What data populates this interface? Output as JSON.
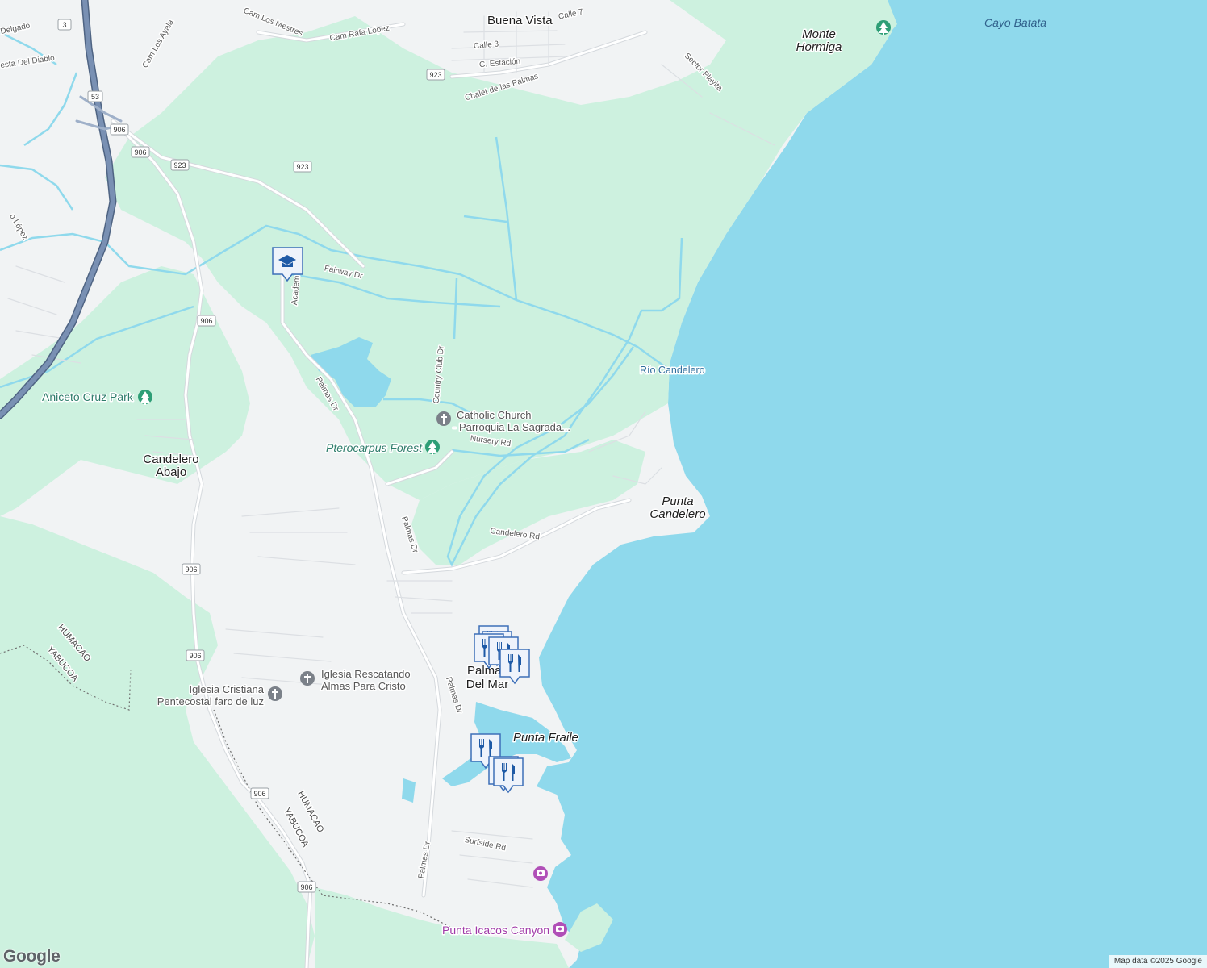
{
  "map": {
    "places": {
      "buena_vista": "Buena Vista",
      "monte_hormiga": [
        "Monte",
        "Hormiga"
      ],
      "cayo_batata": "Cayo Batata",
      "candelero_abajo": [
        "Candelero",
        "Abajo"
      ],
      "punta_candelero": [
        "Punta",
        "Candelero"
      ],
      "palmas_del_mar": [
        "Palmas",
        "Del Mar"
      ],
      "punta_fraile": "Punta Fraile"
    },
    "pois": {
      "aniceto_cruz_park": "Aniceto Cruz Park",
      "pterocarpus_forest": "Pterocarpus Forest",
      "catholic_church": [
        "Catholic Church",
        "- Parroquia La Sagrada..."
      ],
      "iglesia_rescatando": [
        "Iglesia Rescatando",
        "Almas Para Cristo"
      ],
      "iglesia_cristiana": [
        "Iglesia Cristiana",
        "Pentecostal faro de luz"
      ],
      "punta_icacos_canyon": "Punta Icacos Canyon",
      "rio_candelero": "Río Candelero"
    },
    "roads": {
      "calle_7": "Calle 7",
      "calle_3": "Calle 3",
      "c_estacion": "C. Estación",
      "chalet": "Chalet de las Palmas",
      "cam_rafa_lopez": "Cam Rafa López",
      "cam_los_mestres": "Cam Los Mestres",
      "cam_los_ayala": "Cam Los Ayala",
      "cuesta_del_diablo": "esta Del Diablo",
      "delgado": "Delgado",
      "lopez_partial": "o López",
      "sector_playita": "Sector Playita",
      "fairway_dr": "Fairway Dr",
      "academia": "Academ",
      "country_club_dr": "Country Club Dr",
      "palmas_dr": "Palmas Dr",
      "nursery_rd": "Nursery Rd",
      "candelero_rd": "Candelero Rd",
      "surfside_rd": "Surfside Rd"
    },
    "route_shields": [
      "3",
      "53",
      "906",
      "923"
    ],
    "boundaries": {
      "humacao": "HUMACAO",
      "yabucoa": "YABUCOA"
    },
    "colors": {
      "water": "#8fd9ec",
      "land": "#f1f3f4",
      "park": "#cdf1df",
      "highway": "#6b84a8",
      "road": "#ffffff",
      "poi_green": "#2e9e76",
      "poi_gray": "#7b8189",
      "poi_purple": "#b04fb7",
      "food_marker": "#1e5aa6"
    },
    "icons": [
      "school-marker",
      "park-icon",
      "church-icon",
      "restaurant-marker",
      "camera-icon"
    ]
  },
  "footer": {
    "attribution": "Map data ©2025 Google",
    "logo": "Google"
  }
}
